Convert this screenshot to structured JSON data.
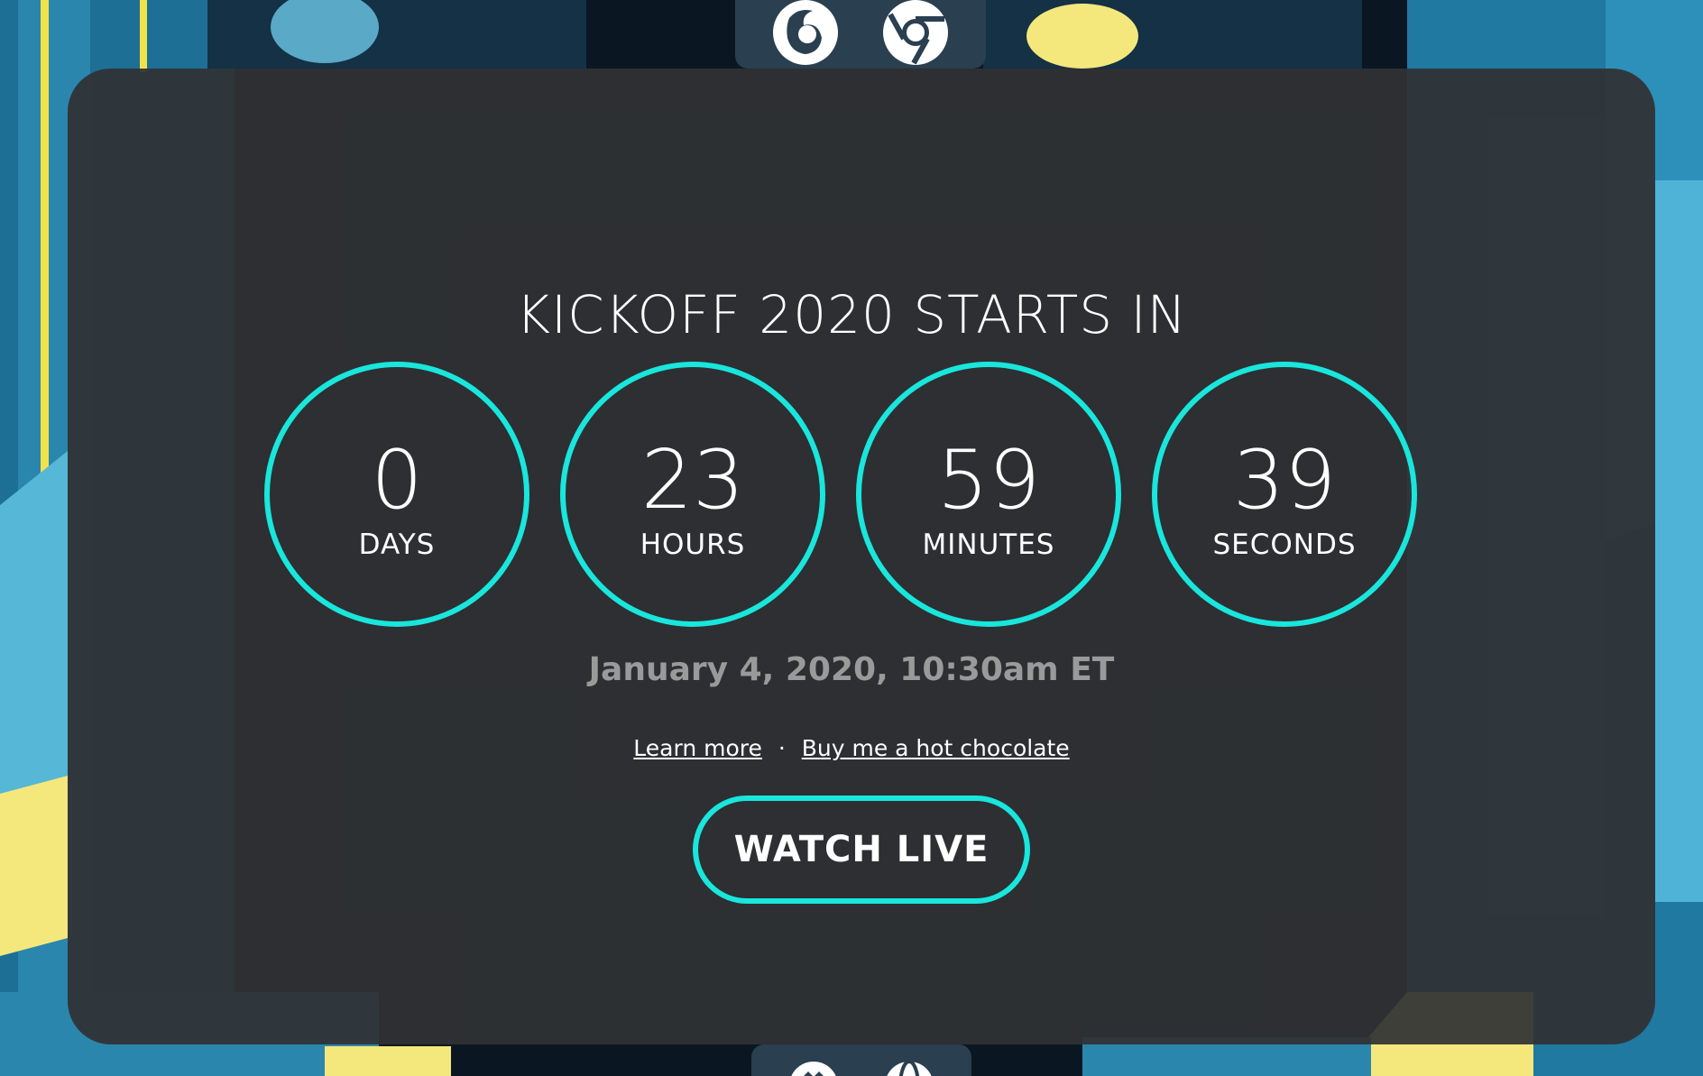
{
  "header": {
    "title": "KICKOFF 2020 STARTS IN"
  },
  "countdown": [
    {
      "value": "0",
      "unit": "DAYS"
    },
    {
      "value": "23",
      "unit": "HOURS"
    },
    {
      "value": "59",
      "unit": "MINUTES"
    },
    {
      "value": "39",
      "unit": "SECONDS"
    }
  ],
  "event_date": "January 4, 2020, 10:30am ET",
  "links": {
    "learn_more": "Learn more",
    "separator": "·",
    "donate": "Buy me a hot chocolate"
  },
  "cta": {
    "watch_live": "WATCH LIVE"
  },
  "top_dock": {
    "icons": [
      "firefox-icon",
      "chrome-icon"
    ]
  },
  "bottom_dock": {
    "icons": [
      "github-icon",
      "globe-icon"
    ]
  },
  "colors": {
    "accent": "#19e6dc",
    "panel": "#303234",
    "text": "#ffffff",
    "muted_text": "#9a9a9a"
  }
}
